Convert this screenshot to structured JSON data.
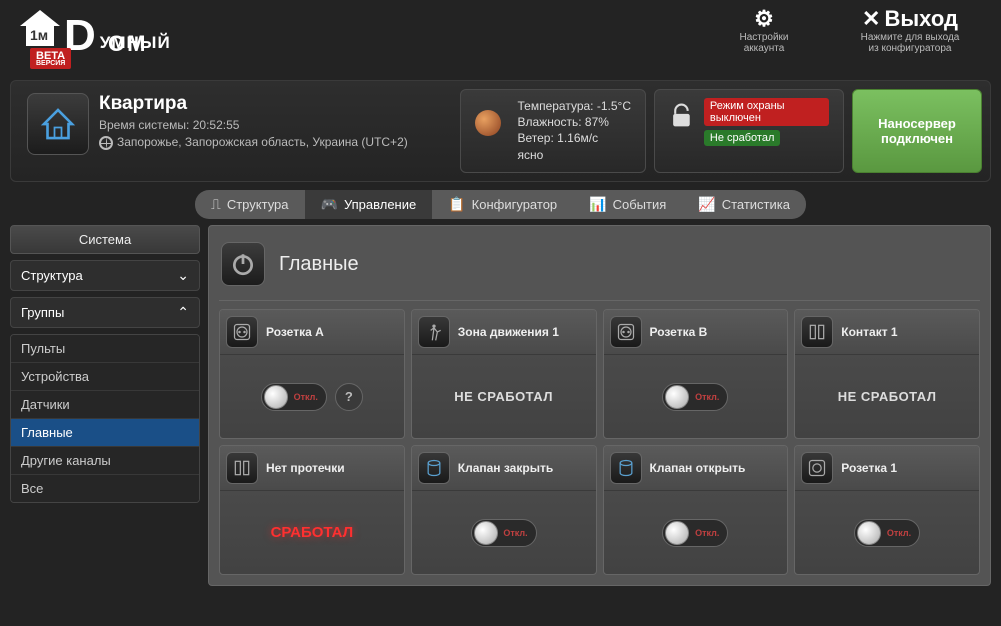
{
  "logo": {
    "line1": "УМНЫЙ",
    "line2": "ОМ",
    "beta": "BETA",
    "beta_sub": "ВЕРСИЯ"
  },
  "topright": {
    "settings": {
      "sub1": "Настройки",
      "sub2": "аккаунта"
    },
    "exit": {
      "title": "Выход",
      "sub1": "Нажмите для выхода",
      "sub2": "из конфигуратора"
    }
  },
  "home": {
    "title": "Квартира",
    "time_label": "Время системы:",
    "time_value": "20:52:55",
    "location": "Запорожье, Запорожская область, Украина (UTC+2)"
  },
  "weather": {
    "temp_label": "Температура:",
    "temp_value": "-1.5°C",
    "hum_label": "Влажность:",
    "hum_value": "87%",
    "wind_label": "Ветер:",
    "wind_value": "1.16м/с",
    "cond": "ясно"
  },
  "security": {
    "mode": "Режим охраны выключен",
    "status": "Не сработал"
  },
  "server": {
    "line1": "Наносервер",
    "line2": "подключен"
  },
  "tabs": {
    "structure": "Структура",
    "control": "Управление",
    "config": "Конфигуратор",
    "events": "События",
    "stats": "Статистика"
  },
  "sidebar": {
    "system": "Система",
    "structure": "Структура",
    "groups": "Группы",
    "items": [
      "Пульты",
      "Устройства",
      "Датчики",
      "Главные",
      "Другие каналы",
      "Все"
    ]
  },
  "section": {
    "title": "Главные"
  },
  "toggle_off": "Откл.",
  "cards": [
    {
      "title": "Розетка А",
      "icon": "socket",
      "body": "toggle_help"
    },
    {
      "title": "Зона движения 1",
      "icon": "motion",
      "body": "status",
      "status": "НЕ СРАБОТАЛ"
    },
    {
      "title": "Розетка В",
      "icon": "socket",
      "body": "toggle"
    },
    {
      "title": "Контакт 1",
      "icon": "contact",
      "body": "status",
      "status": "НЕ СРАБОТАЛ"
    },
    {
      "title": "Нет протечки",
      "icon": "contact",
      "body": "status_red",
      "status": "СРАБОТАЛ"
    },
    {
      "title": "Клапан закрыть",
      "icon": "valve",
      "body": "toggle"
    },
    {
      "title": "Клапан открыть",
      "icon": "valve",
      "body": "toggle"
    },
    {
      "title": "Розетка 1",
      "icon": "socket2",
      "body": "toggle"
    }
  ]
}
